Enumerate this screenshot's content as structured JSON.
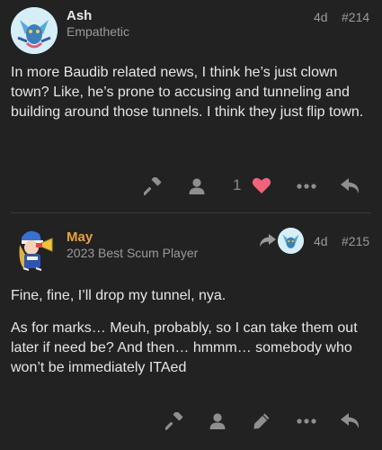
{
  "posts": [
    {
      "username": "Ash",
      "user_title": "Empathetic",
      "age": "4d",
      "post_number": "#214",
      "paragraphs": [
        "In more Baudib related news, I think he’s just clown town? Like, he’s prone to accusing and tunneling and building around those tunnels. I think they just flip town."
      ],
      "like_count": "1",
      "username_color": "#e8e8e8",
      "like_color": "#f0637b",
      "actions": [
        "hammer-icon",
        "user-icon",
        "heart-icon",
        "more-icon",
        "reply-icon"
      ]
    },
    {
      "username": "May",
      "user_title": "2023 Best Scum Player",
      "age": "4d",
      "post_number": "#215",
      "paragraphs": [
        "Fine, fine, I’ll drop my tunnel, nya.",
        "As for marks… Meuh, probably, so I can take them out later if need be? And then… hmmm… somebody who won’t be immediately ITAed"
      ],
      "username_color": "#e8a33a",
      "actions": [
        "hammer-icon",
        "user-icon",
        "pencil-icon",
        "more-icon",
        "reply-icon"
      ]
    }
  ],
  "colors": {
    "background": "#222222",
    "muted": "#9a9a9a",
    "icon": "#8f8f8f"
  }
}
